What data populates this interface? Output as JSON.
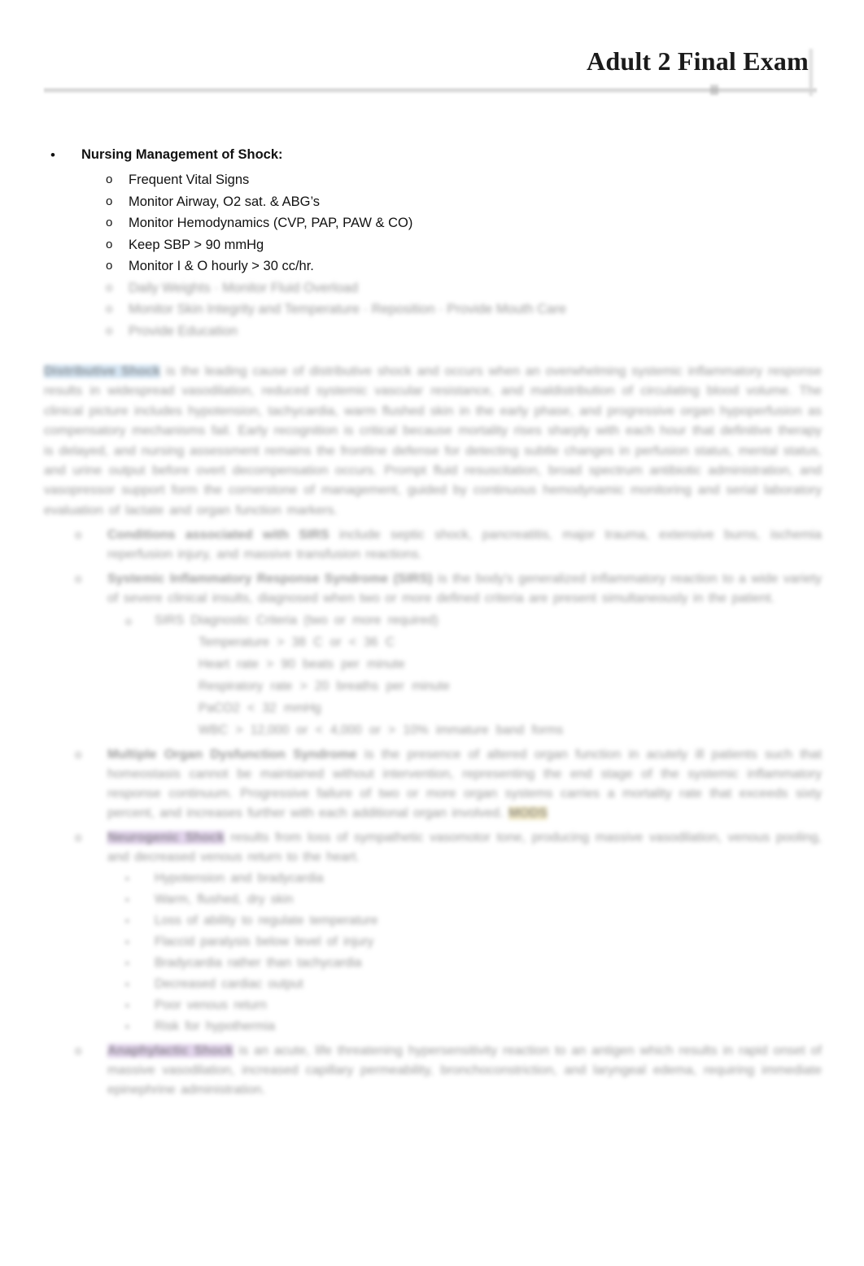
{
  "header": {
    "title": "Adult 2 Final Exam"
  },
  "main": {
    "section_heading": "Nursing Management of Shock:",
    "bullet_marker": "•",
    "sub_marker": "o",
    "sub_marker_dash": "▪",
    "sub_items": [
      "Frequent Vital Signs",
      "Monitor Airway, O2 sat. & ABG’s",
      "Monitor Hemodynamics (CVP, PAP, PAW & CO)",
      "Keep SBP > 90 mmHg",
      "Monitor I & O hourly > 30 cc/hr."
    ],
    "redacted_sub_items": [
      "Daily Weights · Monitor Fluid Overload",
      "Monitor Skin Integrity and Temperature · Reposition · Provide Mouth Care",
      "Provide Education"
    ],
    "redacted_paragraph": {
      "highlight_term": "Distributive Shock",
      "highlight_color": "#d6e6f4",
      "lines": [
        "is the leading cause of distributive shock and occurs when an overwhelming systemic inflammatory response results in widespread vasodilation, reduced systemic vascular resistance, and maldistribution of circulating blood volume. The clinical picture includes hypotension, tachycardia, warm flushed skin in the early phase, and progressive organ hypoperfusion as compensatory mechanisms fail. Early recognition is critical because mortality rises sharply with each hour that definitive therapy is delayed, and nursing assessment remains the frontline defense for detecting subtle changes in perfusion status, mental status, and urine output before overt decompensation occurs. Prompt fluid resuscitation, broad spectrum antibiotic administration, and vasopressor support form the cornerstone of management, guided by continuous hemodynamic monitoring and serial laboratory evaluation of lactate and organ function markers."
      ]
    },
    "redacted_numbered_items": [
      {
        "lead": "Conditions associated with SIRS",
        "body": "include septic shock, pancreatitis, major trauma, extensive burns, ischemia reperfusion injury, and massive transfusion reactions."
      },
      {
        "lead": "Systemic Inflammatory Response Syndrome (SIRS)",
        "body": "is the body's generalized inflammatory reaction to a wide variety of severe clinical insults, diagnosed when two or more defined criteria are present simultaneously in the patient."
      }
    ],
    "redacted_criteria": {
      "title": "SIRS Diagnostic Criteria (two or more required)",
      "rows": [
        "Temperature   >  38 C   or  <  36 C",
        "Heart rate   >   90 beats per minute",
        "Respiratory rate   >   20 breaths per minute",
        "PaCO2   <   32 mmHg",
        "WBC   >  12,000   or   <  4,000   or  > 10% immature band forms"
      ]
    },
    "redacted_mods": {
      "lead": "Multiple Organ Dysfunction Syndrome",
      "body": "is the presence of altered organ function in acutely ill patients such that homeostasis cannot be maintained without intervention, representing the end stage of the systemic inflammatory response continuum. Progressive failure of two or more organ systems carries a mortality rate that exceeds sixty percent, and increases further with each additional organ involved.",
      "highlight_term": "MODS",
      "highlight_color": "#f3ebc9"
    },
    "redacted_neurogenic": {
      "lead": "Neurogenic Shock",
      "highlight_color": "#e2d4ec",
      "body": "results from loss of sympathetic vasomotor tone, producing massive vasodilation, venous pooling, and decreased venous return to the heart.",
      "bullets": [
        "Hypotension and bradycardia",
        "Warm, flushed, dry skin",
        "Loss of ability to regulate temperature",
        "Flaccid paralysis below level of injury",
        "Bradycardia rather than tachycardia",
        "Decreased cardiac output",
        "Poor venous return",
        "Risk for hypothermia"
      ]
    },
    "redacted_anaphylactic": {
      "lead": "Anaphylactic Shock",
      "highlight_color": "#e2d4ec",
      "body": "is an acute, life threatening hypersensitivity reaction to an antigen which results in rapid onset of massive vasodilation, increased capillary permeability, bronchoconstriction, and laryngeal edema, requiring immediate epinephrine administration."
    }
  }
}
